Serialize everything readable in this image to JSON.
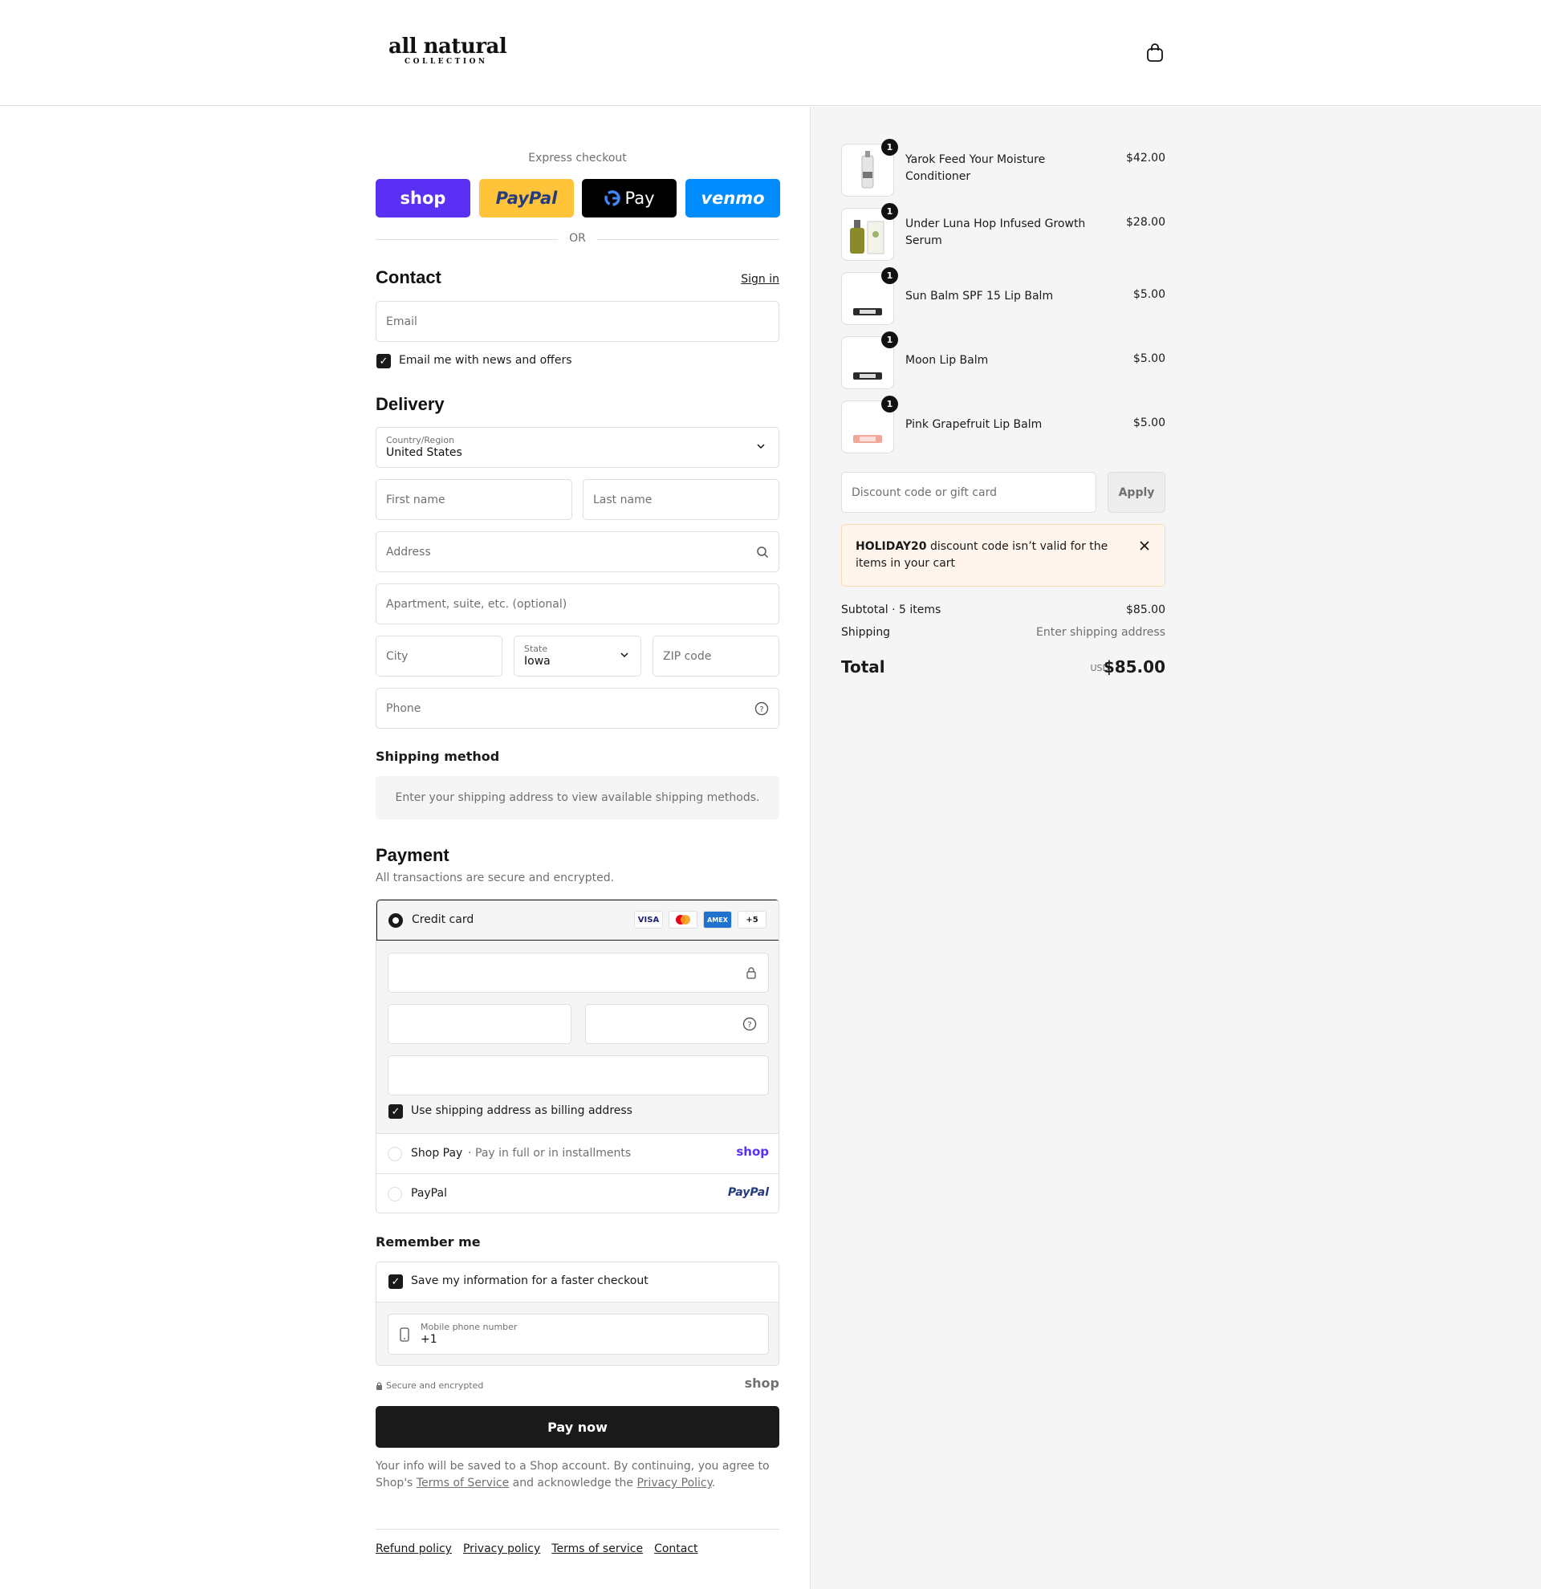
{
  "brand": {
    "logo_main": "all natural",
    "logo_sub": "COLLECTION"
  },
  "express": {
    "label": "Express checkout",
    "buttons": [
      {
        "label": "shop",
        "bg": "#5a31f4",
        "fg": "#ffffff"
      },
      {
        "label": "PayPal",
        "bg": "#ffc439",
        "fg": "#253b80"
      },
      {
        "label": "Pay",
        "bg": "#000000",
        "fg": "#ffffff"
      },
      {
        "label": "venmo",
        "bg": "#008cff",
        "fg": "#ffffff"
      }
    ],
    "or": "OR"
  },
  "contact": {
    "title": "Contact",
    "sign_in": "Sign in",
    "email_placeholder": "Email",
    "news_label": "Email me with news and offers"
  },
  "delivery": {
    "title": "Delivery",
    "country_label": "Country/Region",
    "country_value": "United States",
    "first_name": "First name",
    "last_name": "Last name",
    "address": "Address",
    "apartment": "Apartment, suite, etc. (optional)",
    "city": "City",
    "state_label": "State",
    "state_value": "Iowa",
    "zip": "ZIP code",
    "phone": "Phone"
  },
  "shipping_method": {
    "title": "Shipping method",
    "note": "Enter your shipping address to view available shipping methods."
  },
  "payment": {
    "title": "Payment",
    "subtitle": "All transactions are secure and encrypted.",
    "credit_card": "Credit card",
    "card_icons": [
      "VISA",
      "",
      "AMEX",
      "+5"
    ],
    "billing_label": "Use shipping address as billing address",
    "shop_pay": "Shop Pay",
    "shop_pay_sub": "Pay in full or in installments",
    "shop_logo": "shop",
    "paypal": "PayPal",
    "paypal_logo": "PayPal"
  },
  "remember": {
    "title": "Remember me",
    "save_label": "Save my information for a faster checkout",
    "mobile_label": "Mobile phone number",
    "mobile_value": "+1",
    "secure": "Secure and encrypted",
    "shop_logo": "shop"
  },
  "pay_now": "Pay now",
  "legal": {
    "prefix": "Your info will be saved to a Shop account. By continuing, you agree to Shop's",
    "tos": "Terms of Service",
    "middle": "and acknowledge the",
    "privacy": "Privacy Policy",
    "end": "."
  },
  "footer_links": [
    "Refund policy",
    "Privacy policy",
    "Terms of service",
    "Contact"
  ],
  "cart": {
    "items": [
      {
        "name": "Yarok Feed Your Moisture Conditioner",
        "price": "$42.00",
        "qty": "1"
      },
      {
        "name": "Under Luna Hop Infused Growth Serum",
        "price": "$28.00",
        "qty": "1"
      },
      {
        "name": "Sun Balm SPF 15 Lip Balm",
        "price": "$5.00",
        "qty": "1"
      },
      {
        "name": "Moon Lip Balm",
        "price": "$5.00",
        "qty": "1"
      },
      {
        "name": "Pink Grapefruit Lip Balm",
        "price": "$5.00",
        "qty": "1"
      }
    ],
    "discount_placeholder": "Discount code or gift card",
    "apply": "Apply",
    "notice_code": "HOLIDAY20",
    "notice_text": "discount code isn’t valid for the items in your cart",
    "subtotal_label": "Subtotal · 5 items",
    "subtotal": "$85.00",
    "shipping_label": "Shipping",
    "shipping_value": "Enter shipping address",
    "total_label": "Total",
    "currency": "USD",
    "total": "$85.00"
  }
}
